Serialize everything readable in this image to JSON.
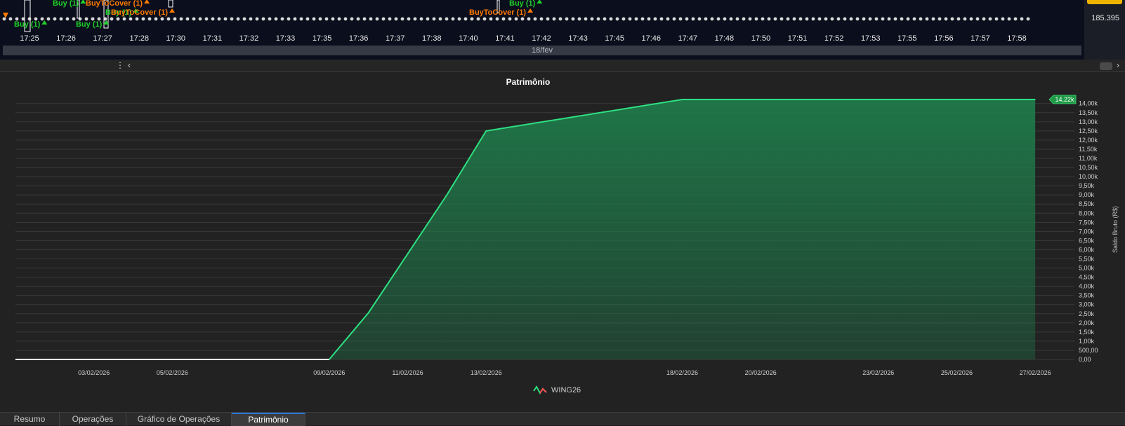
{
  "top_chart": {
    "time_labels": [
      "17:25",
      "17:26",
      "17:27",
      "17:28",
      "17:30",
      "17:31",
      "17:32",
      "17:33",
      "17:35",
      "17:36",
      "17:37",
      "17:38",
      "17:40",
      "17:41",
      "17:42",
      "17:43",
      "17:45",
      "17:46",
      "17:47",
      "17:48",
      "17:50",
      "17:51",
      "17:52",
      "17:53",
      "17:55",
      "17:56",
      "17:57",
      "17:58"
    ],
    "date_label": "18/fev",
    "price_label": "185.395",
    "trade_labels": [
      {
        "text": "Buy (1)",
        "type": "buy"
      },
      {
        "text": "Buy (1)",
        "type": "buy"
      },
      {
        "text": "Buy (1)",
        "type": "buy"
      },
      {
        "text": "Buy (1)",
        "type": "buy"
      },
      {
        "text": "BuyToCover (1)",
        "type": "cover"
      },
      {
        "text": "BuyToCover (1)",
        "type": "cover"
      },
      {
        "text": "BuyToCover (1)",
        "type": "cover"
      },
      {
        "text": "Buy (1)",
        "type": "buy"
      }
    ],
    "colors": {
      "buy": "#1fd12a",
      "cover": "#ff7a00",
      "background": "#0b0e1c"
    }
  },
  "scroll_icons": {
    "menu": "menu-dots-icon",
    "left": "chevron-left-icon",
    "right": "chevron-right-icon"
  },
  "patrimonio": {
    "title": "Patrimônio",
    "legend_label": "WING26",
    "current_value_label": "14,22k",
    "chart_data": {
      "type": "area",
      "title": "Patrimônio",
      "ylabel": "Saldo Bruto (R$)",
      "xlabel": "",
      "x": [
        "01/02/2026",
        "09/02/2026",
        "10/02/2026",
        "12/02/2026",
        "13/02/2026",
        "18/02/2026",
        "27/02/2026"
      ],
      "y": [
        0,
        0,
        2550,
        9000,
        12500,
        14220,
        14220
      ],
      "x_tick_labels": [
        "03/02/2026",
        "05/02/2026",
        "09/02/2026",
        "11/02/2026",
        "13/02/2026",
        "18/02/2026",
        "20/02/2026",
        "23/02/2026",
        "25/02/2026",
        "27/02/2026"
      ],
      "y_tick_labels": [
        "0,00",
        "500,00",
        "1,00k",
        "1,50k",
        "2,00k",
        "2,50k",
        "3,00k",
        "3,50k",
        "4,00k",
        "4,50k",
        "5,00k",
        "5,50k",
        "6,00k",
        "6,50k",
        "7,00k",
        "7,50k",
        "8,00k",
        "8,50k",
        "9,00k",
        "9,50k",
        "10,00k",
        "10,50k",
        "11,00k",
        "11,50k",
        "12,00k",
        "12,50k",
        "13,00k",
        "13,50k",
        "14,00k"
      ],
      "ylim": [
        0,
        14220
      ],
      "grid": true,
      "legend_position": "bottom",
      "series": [
        {
          "name": "WING26"
        }
      ],
      "colors": {
        "line": "#2ee082",
        "fill": "#1f7a4a",
        "flag": "#1e9a45"
      }
    }
  },
  "tabs": [
    {
      "label": "Resumo",
      "active": false
    },
    {
      "label": "Operações",
      "active": false
    },
    {
      "label": "Gráfico de Operações",
      "active": false
    },
    {
      "label": "Patrimônio",
      "active": true
    }
  ]
}
